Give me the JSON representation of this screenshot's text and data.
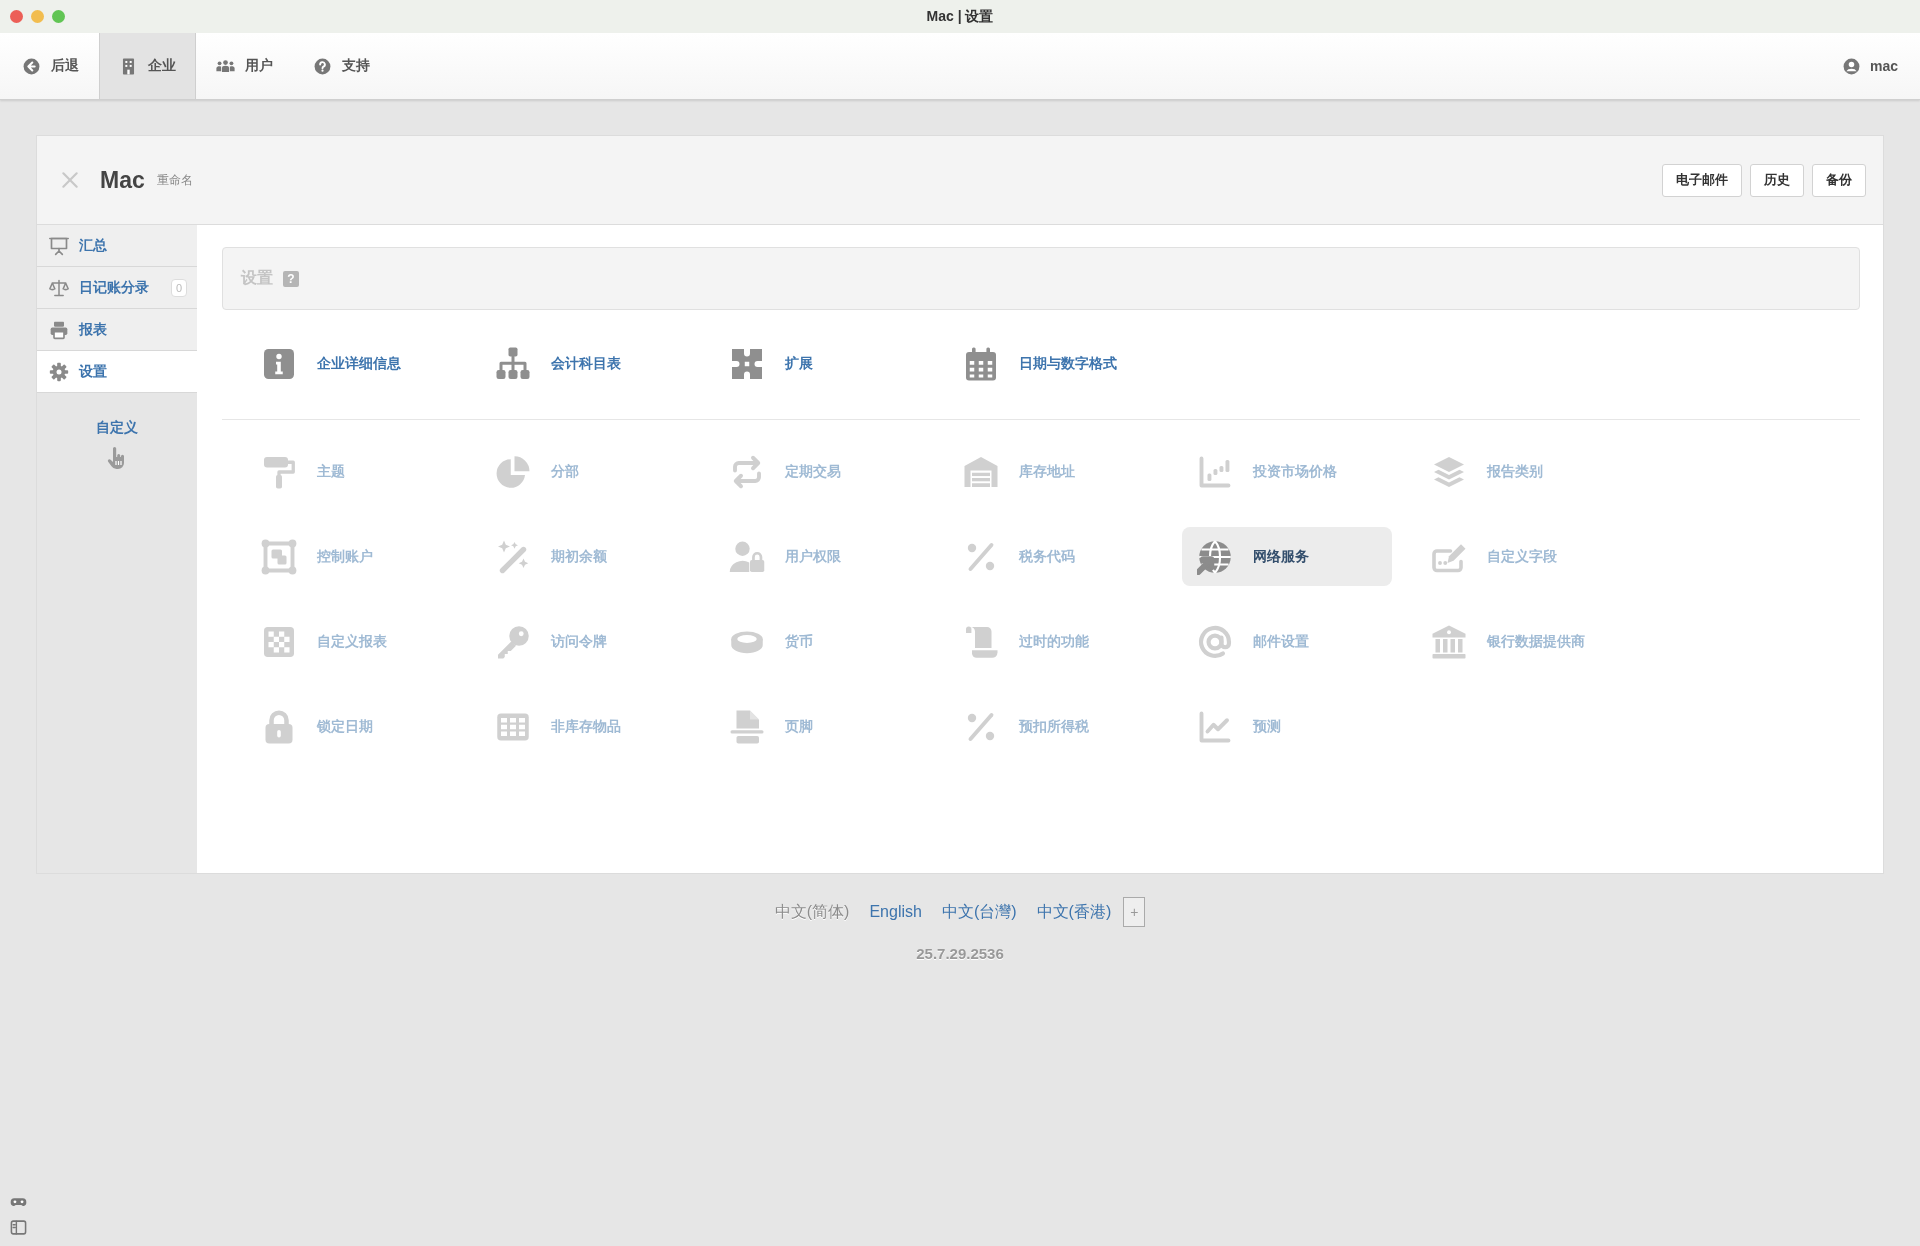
{
  "window": {
    "title": "Mac | 设置"
  },
  "toolbar": {
    "items": [
      {
        "label": "后退",
        "selected": false
      },
      {
        "label": "企业",
        "selected": true
      },
      {
        "label": "用户",
        "selected": false
      },
      {
        "label": "支持",
        "selected": false
      }
    ],
    "user": "mac"
  },
  "company": {
    "name": "Mac",
    "rename": "重命名",
    "buttons": [
      "电子邮件",
      "历史",
      "备份"
    ]
  },
  "sidebar": {
    "items": [
      {
        "label": "汇总",
        "selected": false
      },
      {
        "label": "日记账分录",
        "selected": false,
        "badge": "0"
      },
      {
        "label": "报表",
        "selected": false
      },
      {
        "label": "设置",
        "selected": true
      }
    ],
    "customize": "自定义"
  },
  "settings": {
    "title": "设置",
    "help": "?"
  },
  "main_links": [
    {
      "label": "企业详细信息"
    },
    {
      "label": "会计科目表"
    },
    {
      "label": "扩展"
    },
    {
      "label": "日期与数字格式"
    }
  ],
  "settings_items": [
    {
      "label": "主题",
      "disabled": true,
      "selected": false
    },
    {
      "label": "分部",
      "disabled": true,
      "selected": false
    },
    {
      "label": "定期交易",
      "disabled": true,
      "selected": false
    },
    {
      "label": "库存地址",
      "disabled": true,
      "selected": false
    },
    {
      "label": "投资市场价格",
      "disabled": true,
      "selected": false
    },
    {
      "label": "报告类别",
      "disabled": true,
      "selected": false
    },
    {
      "label": "控制账户",
      "disabled": true,
      "selected": false
    },
    {
      "label": "期初余额",
      "disabled": true,
      "selected": false
    },
    {
      "label": "用户权限",
      "disabled": true,
      "selected": false
    },
    {
      "label": "税务代码",
      "disabled": true,
      "selected": false
    },
    {
      "label": "网络服务",
      "disabled": false,
      "selected": true
    },
    {
      "label": "自定义字段",
      "disabled": true,
      "selected": false
    },
    {
      "label": "自定义报表",
      "disabled": true,
      "selected": false
    },
    {
      "label": "访问令牌",
      "disabled": true,
      "selected": false
    },
    {
      "label": "货币",
      "disabled": true,
      "selected": false
    },
    {
      "label": "过时的功能",
      "disabled": true,
      "selected": false
    },
    {
      "label": "邮件设置",
      "disabled": true,
      "selected": false
    },
    {
      "label": "银行数据提供商",
      "disabled": true,
      "selected": false
    },
    {
      "label": "锁定日期",
      "disabled": true,
      "selected": false
    },
    {
      "label": "非库存物品",
      "disabled": true,
      "selected": false
    },
    {
      "label": "页脚",
      "disabled": true,
      "selected": false
    },
    {
      "label": "预扣所得税",
      "disabled": true,
      "selected": false
    },
    {
      "label": "预测",
      "disabled": true,
      "selected": false
    }
  ],
  "languages": [
    {
      "label": "中文(简体)",
      "selected": true
    },
    {
      "label": "English",
      "selected": false
    },
    {
      "label": "中文(台灣)",
      "selected": false
    },
    {
      "label": "中文(香港)",
      "selected": false
    }
  ],
  "add_language": "+",
  "version": "25.7.29.2536"
}
